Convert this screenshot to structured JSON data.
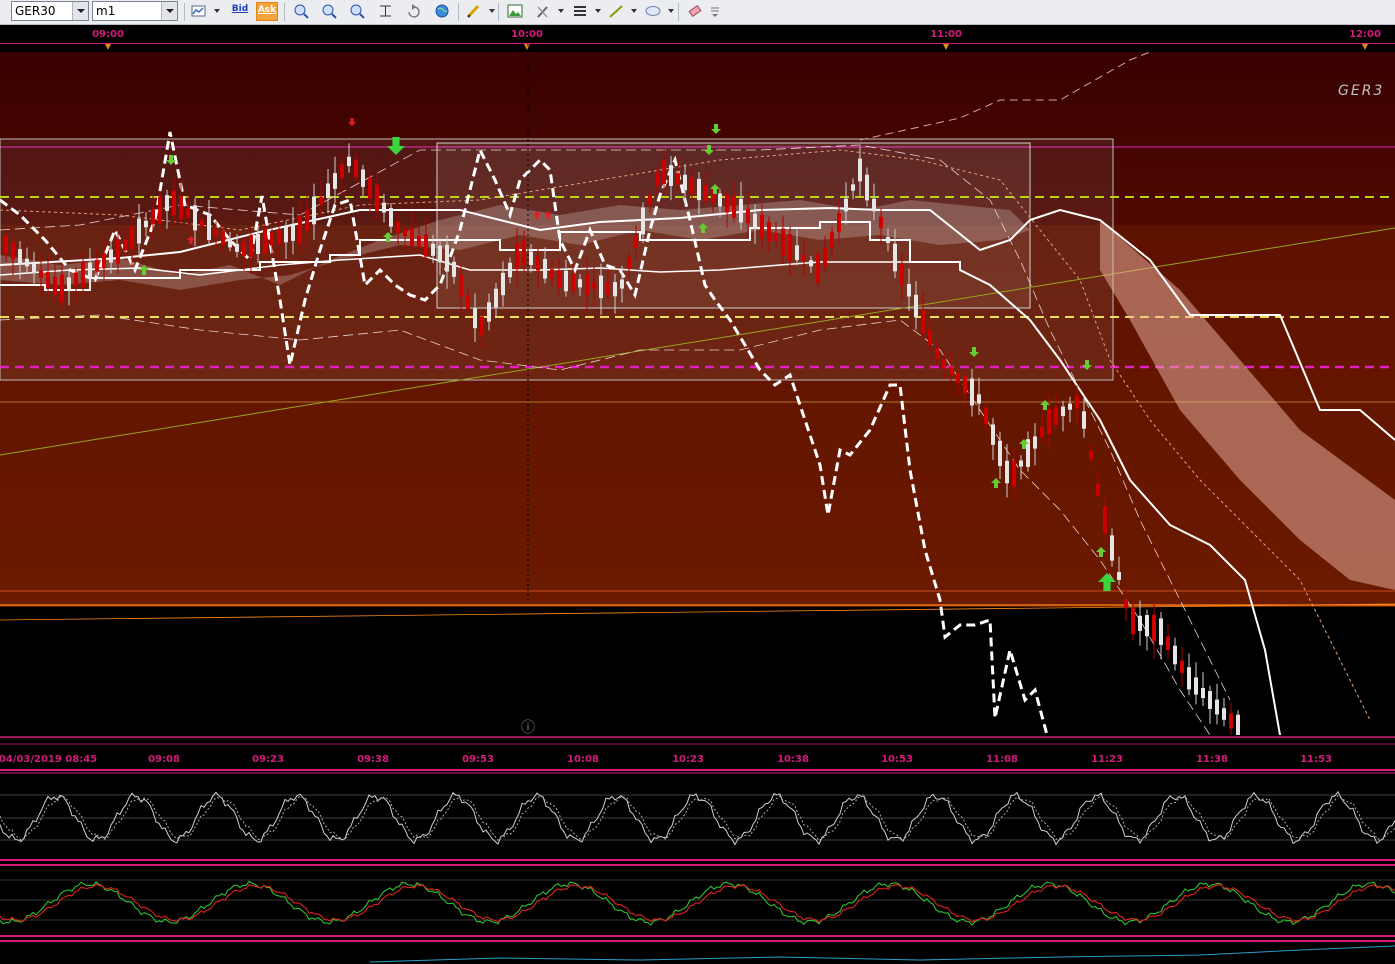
{
  "toolbar": {
    "symbol": "GER30",
    "timeframe": "m1",
    "bid_label": "Bid",
    "ask_label": "Ask"
  },
  "chart": {
    "watermark": "GER3",
    "time_axis_top": [
      "09:00",
      "10:00",
      "11:00",
      "12:00"
    ],
    "time_axis_bottom": [
      "04/03/2019 08:45",
      "09:08",
      "09:23",
      "09:38",
      "09:53",
      "10:08",
      "10:23",
      "10:38",
      "10:53",
      "11:08",
      "11:23",
      "11:38",
      "11:53"
    ],
    "info_glyph": "ⓘ",
    "colors": {
      "background_top": "#3b0000",
      "background_mid": "#6b1a00",
      "label_magenta": "#d6197d",
      "bull_candle": "#e6e6e6",
      "bear_candle": "#cc0000",
      "level_lime": "#b7d417",
      "level_yellow": "#e8df5a",
      "level_magenta": "#e020c0"
    }
  },
  "oscillators": {
    "stochastic": {
      "name": "stochastic-panel"
    },
    "macd": {
      "name": "macd-panel"
    }
  }
}
